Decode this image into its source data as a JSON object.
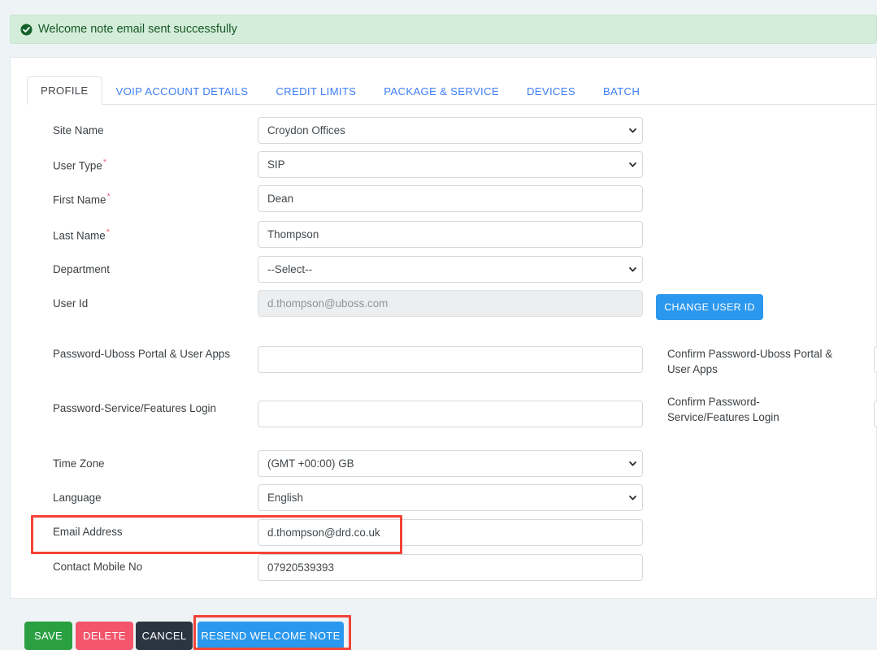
{
  "alert": {
    "icon": "check-circle-icon",
    "message": "Welcome note email sent successfully",
    "bg_color": "#d4edda",
    "text_color": "#155724"
  },
  "tabs": [
    {
      "label": "PROFILE",
      "active": true
    },
    {
      "label": "VOIP ACCOUNT DETAILS",
      "active": false
    },
    {
      "label": "CREDIT LIMITS",
      "active": false
    },
    {
      "label": "PACKAGE & SERVICE",
      "active": false
    },
    {
      "label": "DEVICES",
      "active": false
    },
    {
      "label": "BATCH",
      "active": false
    }
  ],
  "form": {
    "site_name": {
      "label": "Site Name",
      "value": "Croydon Offices",
      "type": "select"
    },
    "user_type": {
      "label": "User Type",
      "required": true,
      "value": "SIP",
      "type": "select"
    },
    "first_name": {
      "label": "First Name",
      "required": true,
      "value": "Dean",
      "type": "text"
    },
    "last_name": {
      "label": "Last Name",
      "required": true,
      "value": "Thompson",
      "type": "text"
    },
    "department": {
      "label": "Department",
      "value": "--Select--",
      "type": "select"
    },
    "user_id": {
      "label": "User Id",
      "value": "d.thompson@uboss.com",
      "type": "text",
      "disabled": true
    },
    "password_portal": {
      "label": "Password-Uboss Portal & User Apps",
      "value": "",
      "type": "password"
    },
    "confirm_password_portal": {
      "label": "Confirm Password-Uboss Portal & User Apps",
      "value": "",
      "type": "password"
    },
    "password_service": {
      "label": "Password-Service/Features Login",
      "value": "",
      "type": "password"
    },
    "confirm_password_service": {
      "label": "Confirm Password-Service/Features Login",
      "value": "",
      "type": "password"
    },
    "time_zone": {
      "label": "Time Zone",
      "value": "(GMT +00:00) GB",
      "type": "select"
    },
    "language": {
      "label": "Language",
      "value": "English",
      "type": "select"
    },
    "email_address": {
      "label": "Email Address",
      "value": "d.thompson@drd.co.uk",
      "type": "text",
      "highlighted": true
    },
    "contact_mobile": {
      "label": "Contact Mobile No",
      "value": "07920539393",
      "type": "text"
    }
  },
  "buttons": {
    "change_user_id": {
      "label": "CHANGE USER ID",
      "color": "#2b98ef"
    },
    "save": {
      "label": "SAVE",
      "color": "#2aa043"
    },
    "delete": {
      "label": "DELETE",
      "color": "#f4556b"
    },
    "cancel": {
      "label": "CANCEL",
      "color": "#2b3542"
    },
    "resend_welcome_note": {
      "label": "RESEND WELCOME NOTE",
      "color": "#2b98ef",
      "highlighted": true
    }
  },
  "annotations": {
    "highlight_color": "#f44336",
    "highlighted_elements": [
      "email-address-row",
      "resend-welcome-note-button"
    ]
  }
}
